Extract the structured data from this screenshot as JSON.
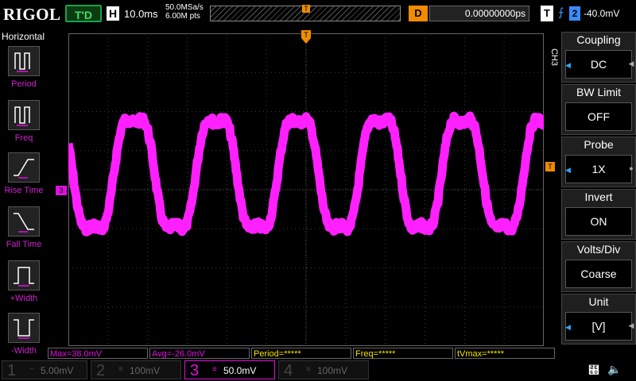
{
  "topbar": {
    "logo": "RIGOL",
    "run_state": "T'D",
    "horizontal_letter": "H",
    "timebase": "10.0ms",
    "sample_rate": "50.0MSa/s",
    "memory_depth": "6.00M pts",
    "mem_marker": "T",
    "delay_letter": "D",
    "delay": "0.00000000ps",
    "trigger_letter": "T",
    "trigger_icon": "rising-edge-icon",
    "trigger_source": "2",
    "trigger_level": "-40.0mV"
  },
  "left_panel": {
    "title": "Horizontal",
    "items": [
      {
        "label": "Period",
        "icon": "period-icon"
      },
      {
        "label": "Freq",
        "icon": "frequency-icon"
      },
      {
        "label": "Rise Time",
        "icon": "rise-time-icon"
      },
      {
        "label": "Fall Time",
        "icon": "fall-time-icon"
      },
      {
        "label": "+Width",
        "icon": "positive-width-icon"
      },
      {
        "label": "-Width",
        "icon": "negative-width-icon"
      }
    ]
  },
  "right_panel": {
    "channel_tag": "CH3",
    "items": [
      {
        "label": "Coupling",
        "value": "DC"
      },
      {
        "label": "BW Limit",
        "value": "OFF"
      },
      {
        "label": "Probe",
        "value": "1X"
      },
      {
        "label": "Invert",
        "value": "ON"
      },
      {
        "label": "Volts/Div",
        "value": "Coarse"
      },
      {
        "label": "Unit",
        "value": "[V]"
      }
    ]
  },
  "markers": {
    "trigger_pos": "T",
    "trigger_level": "T",
    "channel": "3"
  },
  "measurements": [
    {
      "text": "Max=38.0mV",
      "color": "#e010e0"
    },
    {
      "text": "Avg=-26.0mV",
      "color": "#e010e0"
    },
    {
      "text": "Period=*****",
      "color": "#f5e200"
    },
    {
      "text": "Freq=*****",
      "color": "#f5e200"
    },
    {
      "text": "tVmax=*****",
      "color": "#f5e200"
    }
  ],
  "channels": [
    {
      "num": "1",
      "scale": "5.00mV",
      "active": false
    },
    {
      "num": "2",
      "scale": "100mV",
      "active": false
    },
    {
      "num": "3",
      "scale": "50.0mV",
      "active": true
    },
    {
      "num": "4",
      "scale": "100mV",
      "active": false
    }
  ],
  "colors": {
    "trace": "#ff20ff",
    "grid": "#3a3a3a",
    "accent": "#f08c00",
    "channel3": "#e010e0"
  },
  "waveform": {
    "type": "sine",
    "cycles_on_screen": 5.8,
    "center_div": 0.4,
    "amplitude_div": 1.6
  }
}
